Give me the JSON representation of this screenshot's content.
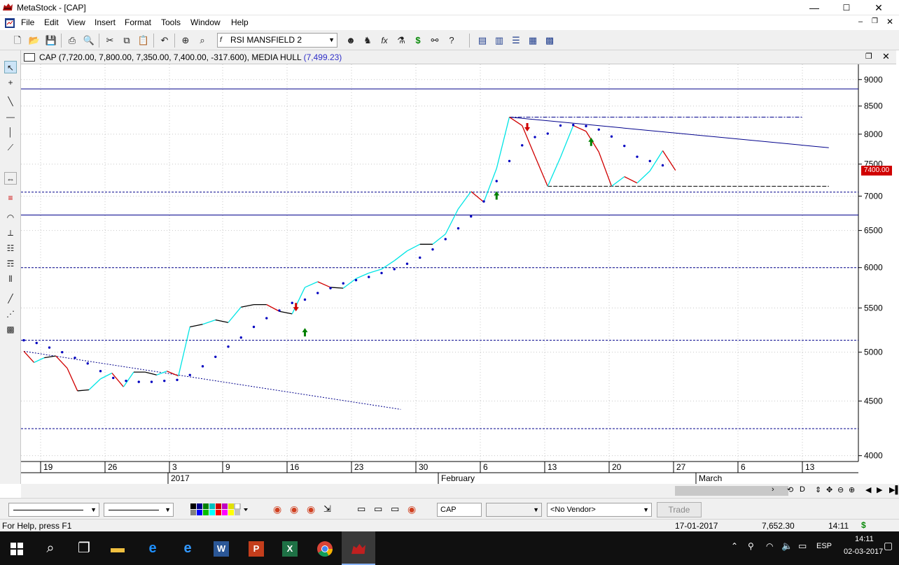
{
  "window": {
    "title": "MetaStock - [CAP]",
    "minimize": "—",
    "maximize": "☐",
    "close": "✕"
  },
  "menu": [
    "File",
    "Edit",
    "View",
    "Insert",
    "Format",
    "Tools",
    "Window",
    "Help"
  ],
  "toolbar": {
    "indicator": "RSI MANSFIELD 2"
  },
  "chart_header": {
    "symbol_values": "CAP (7,720.00, 7,800.00, 7,350.00, 7,400.00, -317.600), MEDIA HULL",
    "hull_value": "(7,499.23)"
  },
  "price_label": "7400.00",
  "chart_data": {
    "type": "line",
    "y_ticks": [
      "9000",
      "8500",
      "8000",
      "7500",
      "7000",
      "6500",
      "6000",
      "5500",
      "5000",
      "4500",
      "4000"
    ],
    "x_day_labels": [
      "19",
      "26",
      "3",
      "9",
      "16",
      "23",
      "30",
      "6",
      "13",
      "20",
      "27",
      "6",
      "13"
    ],
    "x_period_labels": [
      "2017",
      "February",
      "March"
    ],
    "ylim": [
      3950,
      9300
    ],
    "horizontal_lines": [
      {
        "y": 8820,
        "style": "solid"
      },
      {
        "y": 7060,
        "style": "dashed"
      },
      {
        "y": 6720,
        "style": "solid"
      },
      {
        "y": 6000,
        "style": "dashed"
      },
      {
        "y": 5130,
        "style": "dashed"
      },
      {
        "y": 4240,
        "style": "dashed"
      }
    ],
    "series": [
      {
        "points": [
          [
            0,
            5010
          ],
          [
            0.8,
            4890
          ],
          [
            1.6,
            4940
          ],
          [
            2.5,
            4960
          ],
          [
            3.4,
            4830
          ],
          [
            4.2,
            4600
          ],
          [
            5.1,
            4610
          ],
          [
            6.0,
            4720
          ],
          [
            6.9,
            4780
          ],
          [
            7.8,
            4640
          ],
          [
            8.6,
            4790
          ],
          [
            9.5,
            4790
          ],
          [
            10.4,
            4760
          ],
          [
            11.2,
            4800
          ],
          [
            12.1,
            4750
          ],
          [
            13.0,
            5280
          ],
          [
            14.0,
            5310
          ],
          [
            15.0,
            5360
          ],
          [
            16.0,
            5330
          ],
          [
            17.0,
            5510
          ],
          [
            18.0,
            5540
          ],
          [
            19.0,
            5540
          ],
          [
            20.0,
            5460
          ],
          [
            21.0,
            5430
          ],
          [
            22.0,
            5750
          ],
          [
            23.0,
            5820
          ],
          [
            24.0,
            5750
          ],
          [
            25.0,
            5740
          ],
          [
            26.0,
            5860
          ],
          [
            27.0,
            5930
          ],
          [
            28.0,
            5980
          ],
          [
            29.0,
            6090
          ],
          [
            30.0,
            6220
          ],
          [
            31.0,
            6310
          ],
          [
            32.0,
            6310
          ],
          [
            33.0,
            6450
          ],
          [
            34.0,
            6810
          ],
          [
            35.0,
            7070
          ],
          [
            36.0,
            6910
          ],
          [
            37.0,
            7430
          ],
          [
            38.0,
            8300
          ],
          [
            39.0,
            8150
          ],
          [
            40.0,
            7630
          ],
          [
            41.0,
            7150
          ],
          [
            42.0,
            7610
          ],
          [
            43.0,
            8150
          ],
          [
            44.0,
            8050
          ],
          [
            45.0,
            7700
          ],
          [
            46.0,
            7150
          ],
          [
            47.0,
            7300
          ],
          [
            48.0,
            7200
          ],
          [
            49.0,
            7390
          ],
          [
            50.0,
            7720
          ],
          [
            51.0,
            7400
          ]
        ]
      },
      {
        "points": [
          [
            0,
            5130
          ],
          [
            1,
            5100
          ],
          [
            2,
            5050
          ],
          [
            3,
            5000
          ],
          [
            4,
            4940
          ],
          [
            5,
            4880
          ],
          [
            6,
            4800
          ],
          [
            7,
            4730
          ],
          [
            8,
            4700
          ],
          [
            9,
            4690
          ],
          [
            10,
            4690
          ],
          [
            11,
            4700
          ],
          [
            12,
            4710
          ],
          [
            13,
            4760
          ],
          [
            14,
            4850
          ],
          [
            15,
            4950
          ],
          [
            16,
            5060
          ],
          [
            17,
            5160
          ],
          [
            18,
            5280
          ],
          [
            19,
            5380
          ],
          [
            20,
            5470
          ],
          [
            21,
            5560
          ],
          [
            22,
            5600
          ],
          [
            23,
            5680
          ],
          [
            24,
            5740
          ],
          [
            25,
            5800
          ],
          [
            26,
            5840
          ],
          [
            27,
            5880
          ],
          [
            28,
            5930
          ],
          [
            29,
            5980
          ],
          [
            30,
            6050
          ],
          [
            31,
            6130
          ],
          [
            32,
            6240
          ],
          [
            33,
            6380
          ],
          [
            34,
            6530
          ],
          [
            35,
            6700
          ],
          [
            36,
            6920
          ],
          [
            37,
            7230
          ],
          [
            38,
            7550
          ],
          [
            39,
            7810
          ],
          [
            40,
            7950
          ],
          [
            41,
            8010
          ],
          [
            42,
            8150
          ],
          [
            43,
            8160
          ],
          [
            44,
            8140
          ],
          [
            45,
            8080
          ],
          [
            46,
            7960
          ],
          [
            47,
            7800
          ],
          [
            48,
            7620
          ],
          [
            49,
            7550
          ],
          [
            50,
            7480
          ]
        ]
      }
    ],
    "annotations": [
      {
        "type": "arrow-up",
        "x": 22.0,
        "y": 5220,
        "color": "#008000"
      },
      {
        "type": "arrow-down",
        "x": 21.3,
        "y": 5510,
        "color": "#d00000"
      },
      {
        "type": "arrow-up",
        "x": 37.0,
        "y": 7010,
        "color": "#008000"
      },
      {
        "type": "arrow-down",
        "x": 39.4,
        "y": 8120,
        "color": "#d00000"
      },
      {
        "type": "arrow-up",
        "x": 44.4,
        "y": 7870,
        "color": "#008000"
      }
    ]
  },
  "bottombar": {
    "symbol": "CAP",
    "vendor": "<No Vendor>",
    "trade": "Trade"
  },
  "statusbar": {
    "help": "For Help, press F1",
    "date": "17-01-2017",
    "value": "7,652.30",
    "time": "14:11",
    "dollar": "$"
  },
  "taskbar": {
    "lang": "ESP",
    "time": "14:11",
    "date": "02-03-2017"
  },
  "colors": {
    "up": "#00e5e5",
    "down": "#d00000",
    "flat": "#000000",
    "hull_dots": "#0000c0",
    "grid_line": "#00008b",
    "window_bg": "#f0f0f0"
  }
}
